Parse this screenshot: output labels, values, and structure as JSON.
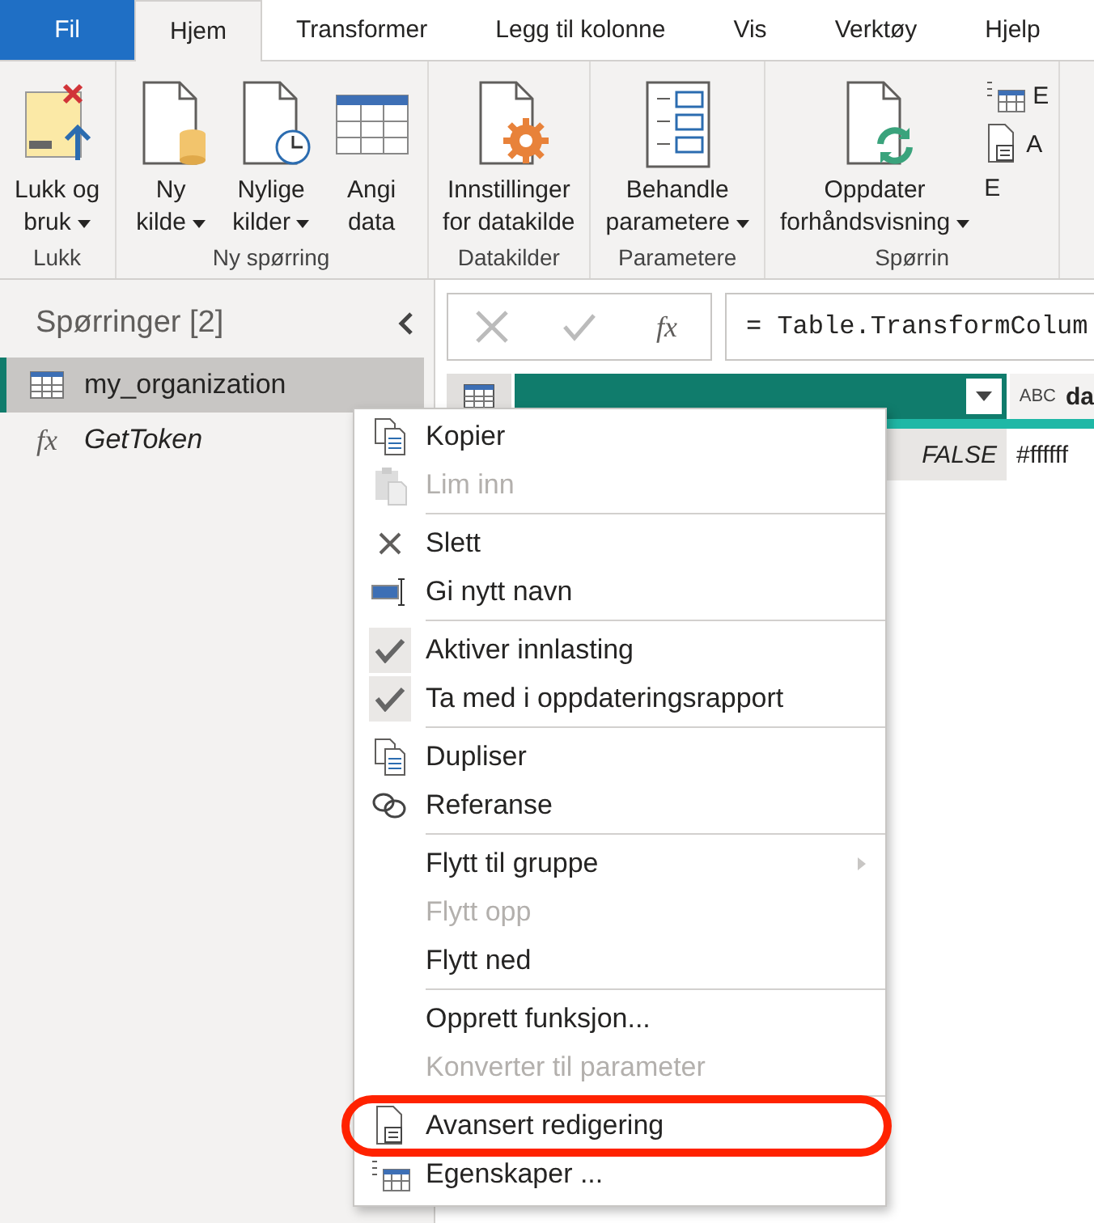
{
  "tabs": [
    {
      "label": "Fil",
      "kind": "file",
      "selected": false
    },
    {
      "label": "Hjem",
      "kind": "tab",
      "selected": true
    },
    {
      "label": "Transformer",
      "kind": "tab",
      "selected": false
    },
    {
      "label": "Legg til kolonne",
      "kind": "tab",
      "selected": false
    },
    {
      "label": "Vis",
      "kind": "tab",
      "selected": false
    },
    {
      "label": "Verktøy",
      "kind": "tab",
      "selected": false
    },
    {
      "label": "Hjelp",
      "kind": "tab",
      "selected": false
    }
  ],
  "ribbon": [
    {
      "label": "Lukk",
      "buttons": [
        {
          "lines": [
            "Lukk og",
            "bruk"
          ],
          "kind": "close-apply",
          "dropdown": true
        }
      ]
    },
    {
      "label": "Ny spørring",
      "buttons": [
        {
          "lines": [
            "Ny",
            "kilde"
          ],
          "kind": "new-source",
          "dropdown": true
        },
        {
          "lines": [
            "Nylige",
            "kilder"
          ],
          "kind": "recent",
          "dropdown": true
        },
        {
          "lines": [
            "Angi",
            "data"
          ],
          "kind": "table",
          "dropdown": false
        }
      ]
    },
    {
      "label": "Datakilder",
      "buttons": [
        {
          "lines": [
            "Innstillinger",
            "for datakilde"
          ],
          "kind": "settings",
          "dropdown": false
        }
      ]
    },
    {
      "label": "Parametere",
      "buttons": [
        {
          "lines": [
            "Behandle",
            "parametere"
          ],
          "kind": "params",
          "dropdown": true
        }
      ]
    },
    {
      "label": "Spørrin",
      "buttons": [
        {
          "lines": [
            "Oppdater",
            "forhåndsvisning"
          ],
          "kind": "refresh",
          "dropdown": true
        }
      ],
      "small": [
        {
          "label": "E",
          "kind": "properties"
        },
        {
          "label": "A",
          "kind": "script"
        },
        {
          "label": "E",
          "kind": "table"
        }
      ]
    }
  ],
  "queries": {
    "title": "Spørringer [2]",
    "items": [
      {
        "label": "my_organization",
        "kind": "table",
        "selected": true
      },
      {
        "label": "GetToken",
        "kind": "function",
        "glyph": "fx",
        "selected": false
      }
    ]
  },
  "formula_bar": {
    "fx": "fx",
    "formula": "= Table.TransformColum"
  },
  "grid": {
    "column_2_header": "da",
    "column_2_type": "ABC",
    "rows": [
      {
        "column_1": "FALSE",
        "column_2": "#ffffff"
      }
    ]
  },
  "context_menu": [
    [
      {
        "label": "Kopier",
        "kind": "copy",
        "disabled": false
      },
      {
        "label": "Lim inn",
        "kind": "paste",
        "disabled": true
      }
    ],
    [
      {
        "label": "Slett",
        "kind": "delete",
        "disabled": false
      },
      {
        "label": "Gi nytt navn",
        "kind": "rename",
        "disabled": false
      }
    ],
    [
      {
        "label": "Aktiver innlasting",
        "kind": "check",
        "disabled": false,
        "checked": true
      },
      {
        "label": "Ta med i oppdateringsrapport",
        "kind": "check",
        "disabled": false,
        "checked": true
      }
    ],
    [
      {
        "label": "Dupliser",
        "kind": "copy",
        "disabled": false
      },
      {
        "label": "Referanse",
        "kind": "link",
        "disabled": false
      }
    ],
    [
      {
        "label": "Flytt til gruppe",
        "kind": "plain",
        "disabled": false,
        "submenu": true
      },
      {
        "label": "Flytt opp",
        "kind": "plain",
        "disabled": true
      },
      {
        "label": "Flytt ned",
        "kind": "plain",
        "disabled": false
      }
    ],
    [
      {
        "label": "Opprett funksjon...",
        "kind": "plain",
        "disabled": false
      },
      {
        "label": "Konverter til parameter",
        "kind": "plain",
        "disabled": true
      }
    ],
    [
      {
        "label": "Avansert redigering",
        "kind": "script",
        "disabled": false,
        "highlighted": true
      },
      {
        "label": "Egenskaper ...",
        "kind": "properties",
        "disabled": false
      }
    ]
  ]
}
